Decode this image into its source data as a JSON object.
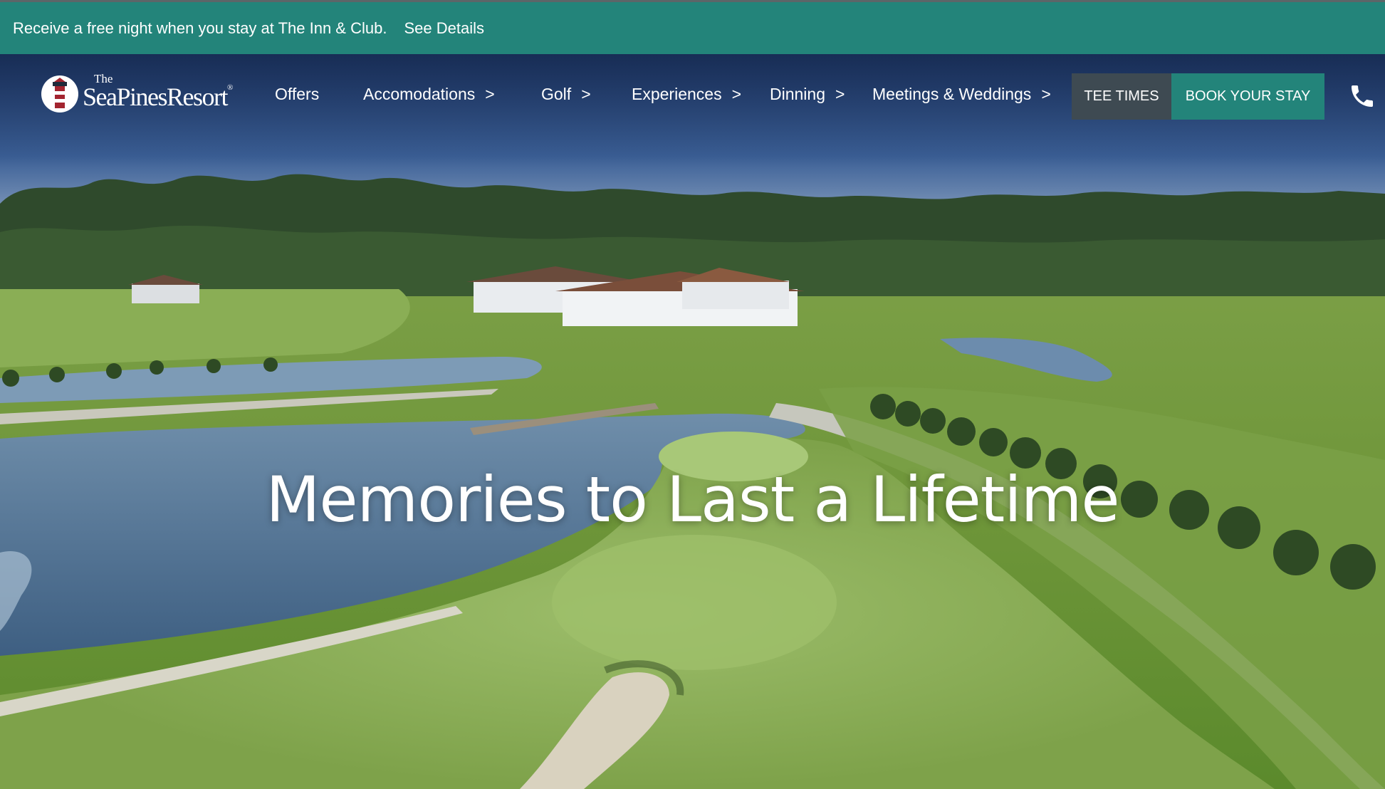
{
  "promo": {
    "text": "Receive a free night when you stay at The Inn & Club.",
    "link": "See Details"
  },
  "logo": {
    "the": "The",
    "name": "SeaPinesResort",
    "reg": "®"
  },
  "nav": {
    "items": [
      {
        "label": "Offers",
        "chevron": ""
      },
      {
        "label": "Accomodations",
        "chevron": ">"
      },
      {
        "label": "Golf",
        "chevron": ">"
      },
      {
        "label": "Experiences",
        "chevron": ">"
      },
      {
        "label": "Dinning",
        "chevron": ">"
      },
      {
        "label": "Meetings & Weddings",
        "chevron": ">"
      }
    ],
    "tee_times": "TEE TIMES",
    "book": "BOOK YOUR STAY",
    "phone_icon": "phone-icon"
  },
  "hero": {
    "headline": "Memories to Last a Lifetime"
  },
  "colors": {
    "brand_teal": "#23847a",
    "tee_button": "#3e4a52"
  }
}
